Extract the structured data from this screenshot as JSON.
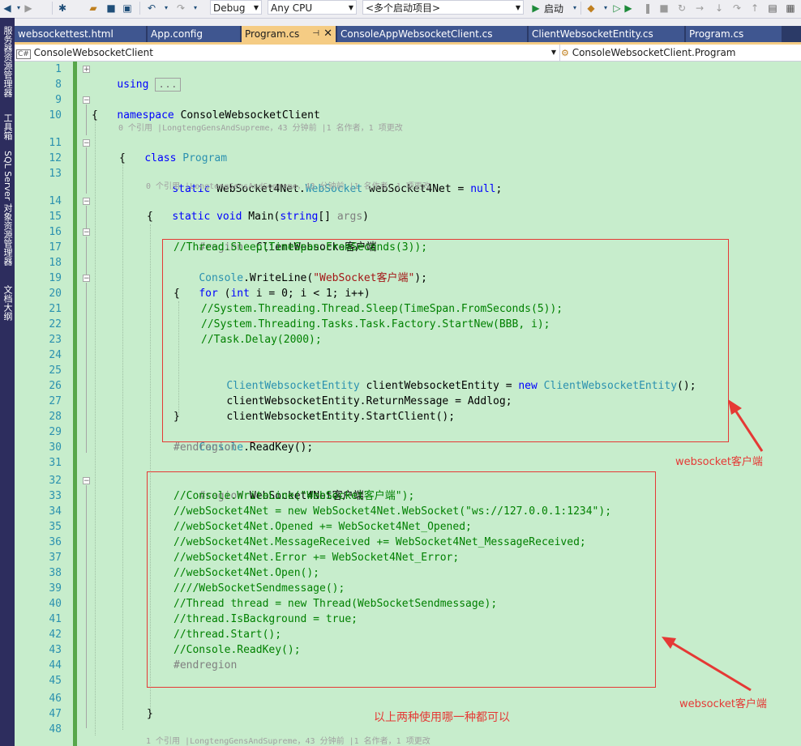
{
  "toolbar": {
    "config": "Debug",
    "platform": "Any CPU",
    "startup": "<多个启动项目>",
    "start_label": "启动"
  },
  "sidebar": {
    "items": [
      "服务器资源管理器",
      "工具箱",
      "SQL Server 对象资源管理器",
      "文档大纲"
    ]
  },
  "tabs": [
    {
      "label": "websockettest.html"
    },
    {
      "label": "App.config"
    },
    {
      "label": "Program.cs",
      "pin": "⊣",
      "close": "✕"
    },
    {
      "label": "ConsoleAppWebsocketClient.cs"
    },
    {
      "label": "ClientWebsocketEntity.cs"
    },
    {
      "label": "Program.cs"
    }
  ],
  "navbar": {
    "project": "ConsoleWebsocketClient",
    "member": "ConsoleWebsocketClient.Program"
  },
  "line_numbers": [
    "1",
    "8",
    "9",
    "10",
    "11",
    "12",
    "13",
    "14",
    "15",
    "16",
    "17",
    "18",
    "19",
    "20",
    "21",
    "22",
    "23",
    "24",
    "25",
    "26",
    "27",
    "28",
    "29",
    "30",
    "31",
    "32",
    "33",
    "34",
    "35",
    "36",
    "37",
    "38",
    "39",
    "40",
    "41",
    "42",
    "43",
    "44",
    "45",
    "46",
    "47",
    "48"
  ],
  "lens": {
    "l1": "0 个引用 |LongtengGensAndSupreme，43 分钟前 |1 名作者，1 项更改",
    "l2": "0 个引用 |LongtengGensAndSupreme，43 分钟前 |1 名作者，1 项更改",
    "l3": "1 个引用 |LongtengGensAndSupreme，43 分钟前 |1 名作者，1 项更改"
  },
  "code": {
    "using_kw": "using",
    "using_collapsed": "...",
    "namespace_kw": "namespace",
    "namespace_name": " ConsoleWebsocketClient",
    "open_brace": "{",
    "close_brace": "}",
    "class_kw": "class",
    "class_name": "Program",
    "static_kw": "static",
    "field_type_ns": "WebSocket4Net.",
    "field_type": "WebSocket",
    "field_rest": " webSocket4Net = ",
    "null_kw": "null",
    "semi": ";",
    "void_kw": "void",
    "main_name": " Main(",
    "string_kw": "string",
    "main_args": "[] ",
    "args": "args",
    "paren_close": ")",
    "region1": "#region",
    "region1_name": "  ClientWebsocke客户端",
    "l17": "//Thread.Sleep(TimeSpan.FromSeconds(3));",
    "console": "Console",
    "writeline": ".WriteLine(",
    "ws_str": "\"WebSocket客户端\"",
    "paren_semi": ");",
    "for_kw": "for",
    "for_open": " (",
    "int_kw": "int",
    "for_rest": " i = 0; i < 1; i++)",
    "l21": "//System.Threading.Thread.Sleep(TimeSpan.FromSeconds(5));",
    "l22": "//System.Threading.Tasks.Task.Factory.StartNew(BBB, i);",
    "l23": "//Task.Delay(2000);",
    "entity_type": "ClientWebsocketEntity",
    "entity_var": " clientWebsocketEntity = ",
    "new_kw": "new",
    "entity_ctor": "ClientWebsocketEntity",
    "ctor_end": "();",
    "l26_a": "clientWebsocketEntity.",
    "l26_b": "ReturnMessage",
    "l26_c": " = ",
    "l26_d": "Addlog",
    "l27_b": "StartClient",
    "readkey": ".ReadKey",
    "readkey_end": "();",
    "endregion": "#endregion",
    "region2": "#region",
    "region2_name": " WebSocket4Net客户端",
    "l33": "//Console.WriteLine(\"WebSocket客户端\");",
    "l34": "//webSocket4Net = new WebSocket4Net.WebSocket(\"ws://127.0.0.1:1234\");",
    "l35": "//webSocket4Net.Opened += WebSocket4Net_Opened;",
    "l36": "//webSocket4Net.MessageReceived += WebSocket4Net_MessageReceived;",
    "l37": "//webSocket4Net.Error += WebSocket4Net_Error;",
    "l38": "//webSocket4Net.Open();",
    "l39": "////WebSocketSendmessage();",
    "l40": "//Thread thread = new Thread(WebSocketSendmessage);",
    "l41": "//thread.IsBackground = true;",
    "l42": "//thread.Start();",
    "l43": "//Console.ReadKey();",
    "endregion2": "#endregion"
  },
  "annotations": {
    "a1": "websocket客户端",
    "a2": "websocket客户端",
    "note": "以上两种使用哪一种都可以"
  },
  "colors": {
    "editor_bg": "#c7edcc",
    "keyword": "#0000ff",
    "type": "#2b91af",
    "comment": "#008000",
    "string": "#a31515",
    "annotation": "#e53935"
  }
}
